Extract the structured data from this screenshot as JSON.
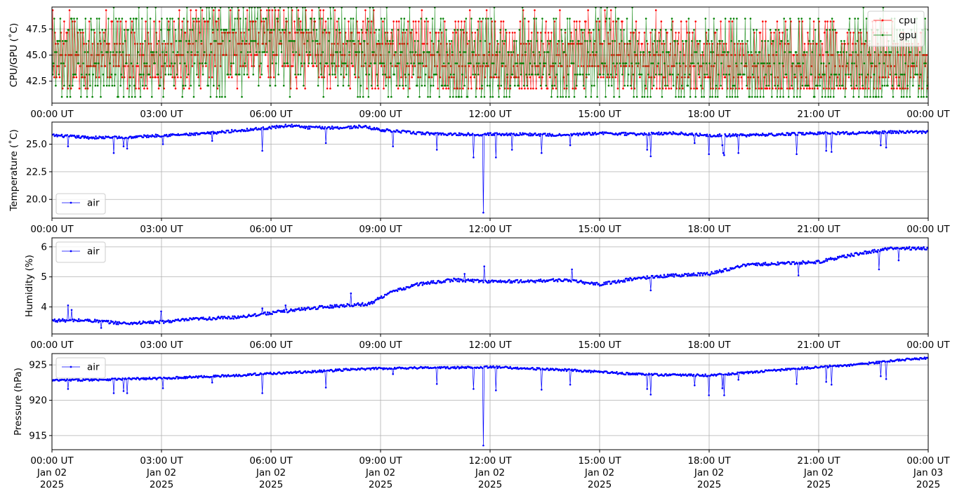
{
  "x_axis": {
    "time_ticks": [
      "00:00 UT",
      "03:00 UT",
      "06:00 UT",
      "09:00 UT",
      "12:00 UT",
      "15:00 UT",
      "18:00 UT",
      "21:00 UT",
      "00:00 UT"
    ],
    "date_ticks": [
      "Jan 02",
      "Jan 02",
      "Jan 02",
      "Jan 02",
      "Jan 02",
      "Jan 02",
      "Jan 02",
      "Jan 02",
      "Jan 03"
    ],
    "year_ticks": [
      "2025",
      "2025",
      "2025",
      "2025",
      "2025",
      "2025",
      "2025",
      "2025",
      "2025"
    ],
    "range": [
      "2025-01-02 00:00 UT",
      "2025-01-03 00:00 UT"
    ]
  },
  "chart_data": [
    {
      "type": "line",
      "ylabel": "CPU/GPU (˚C)",
      "ylim": [
        40.4,
        49.6
      ],
      "yticks": [
        42.5,
        45.0,
        47.5
      ],
      "ytick_labels": [
        "42.5",
        "45.0",
        "47.5"
      ],
      "grid": true,
      "legend_position": "upper right",
      "series": [
        {
          "name": "cpu",
          "color": "#ff0000",
          "marker": "dot",
          "x_hours": [
            0,
            3,
            6,
            9,
            12,
            15,
            18,
            21,
            24
          ],
          "values": [
            44.9,
            45.0,
            46.3,
            45.2,
            44.5,
            45.1,
            44.3,
            44.0,
            44.6
          ],
          "min": 41.8,
          "max": 48.8
        },
        {
          "name": "gpu",
          "color": "#008000",
          "marker": "dot",
          "x_hours": [
            0,
            3,
            6,
            9,
            12,
            15,
            18,
            21,
            24
          ],
          "values": [
            44.6,
            44.8,
            46.5,
            45.0,
            44.2,
            44.9,
            44.1,
            43.8,
            44.3
          ],
          "min": 41.0,
          "max": 49.4
        }
      ]
    },
    {
      "type": "line",
      "ylabel": "Temperature (˚C)",
      "ylim": [
        18.3,
        27.0
      ],
      "yticks": [
        20.0,
        22.5,
        25.0
      ],
      "ytick_labels": [
        "20.0",
        "22.5",
        "25.0"
      ],
      "grid": true,
      "legend_position": "lower left",
      "series": [
        {
          "name": "air",
          "color": "#0000ff",
          "marker": "dot",
          "x_hours": [
            0,
            1,
            2,
            3,
            4,
            5,
            6,
            6.5,
            7,
            8,
            8.5,
            9,
            10,
            11,
            12,
            13,
            14,
            15,
            16,
            17,
            18,
            19,
            20,
            21,
            22,
            23,
            24
          ],
          "values": [
            25.8,
            25.6,
            25.6,
            25.8,
            25.9,
            26.2,
            26.5,
            26.7,
            26.5,
            26.5,
            26.6,
            26.3,
            26.0,
            25.9,
            25.9,
            25.9,
            25.8,
            26.0,
            25.9,
            26.0,
            25.8,
            25.8,
            25.9,
            26.0,
            26.0,
            26.1,
            26.1
          ],
          "dips": [
            [
              0.45,
              24.8
            ],
            [
              1.7,
              24.2
            ],
            [
              1.95,
              24.8
            ],
            [
              2.05,
              24.6
            ],
            [
              3.05,
              25.0
            ],
            [
              4.4,
              25.3
            ],
            [
              5.75,
              24.4
            ],
            [
              7.5,
              25.1
            ],
            [
              9.35,
              24.8
            ],
            [
              10.55,
              24.5
            ],
            [
              11.55,
              23.8
            ],
            [
              11.82,
              18.8
            ],
            [
              12.17,
              23.8
            ],
            [
              12.6,
              24.5
            ],
            [
              13.4,
              24.2
            ],
            [
              14.2,
              24.9
            ],
            [
              16.3,
              24.5
            ],
            [
              16.4,
              23.9
            ],
            [
              17.6,
              25.1
            ],
            [
              18.0,
              24.1
            ],
            [
              18.35,
              24.9
            ],
            [
              18.38,
              24.2
            ],
            [
              18.42,
              24.0
            ],
            [
              18.8,
              24.2
            ],
            [
              20.4,
              24.1
            ],
            [
              21.2,
              24.4
            ],
            [
              21.35,
              24.3
            ],
            [
              22.7,
              24.9
            ],
            [
              22.85,
              24.7
            ]
          ]
        }
      ]
    },
    {
      "type": "line",
      "ylabel": "Humidity (%)",
      "ylim": [
        3.1,
        6.3
      ],
      "yticks": [
        4,
        5,
        6
      ],
      "ytick_labels": [
        "4",
        "5",
        "6"
      ],
      "grid": true,
      "legend_position": "upper left",
      "series": [
        {
          "name": "air",
          "color": "#0000ff",
          "marker": "dot",
          "x_hours": [
            0,
            1,
            2,
            3,
            4,
            5,
            6,
            7,
            8,
            8.7,
            9.2,
            10,
            11,
            12,
            13,
            14,
            15,
            16,
            17,
            18,
            19,
            20,
            21,
            22,
            23,
            24
          ],
          "values": [
            3.55,
            3.55,
            3.45,
            3.5,
            3.6,
            3.65,
            3.8,
            3.95,
            4.05,
            4.1,
            4.45,
            4.75,
            4.9,
            4.85,
            4.85,
            4.9,
            4.75,
            4.95,
            5.05,
            5.1,
            5.4,
            5.45,
            5.5,
            5.75,
            5.95,
            5.95
          ],
          "spikes": [
            [
              0.45,
              4.05
            ],
            [
              0.55,
              3.9
            ],
            [
              1.35,
              3.3
            ],
            [
              3.0,
              3.85
            ],
            [
              5.75,
              3.95
            ],
            [
              6.4,
              4.05
            ],
            [
              8.2,
              4.45
            ],
            [
              11.3,
              5.1
            ],
            [
              11.85,
              5.35
            ],
            [
              14.25,
              5.25
            ],
            [
              16.4,
              4.55
            ],
            [
              20.45,
              5.05
            ],
            [
              22.65,
              5.25
            ],
            [
              23.2,
              5.55
            ]
          ]
        }
      ]
    },
    {
      "type": "line",
      "ylabel": "Pressure (hPa)",
      "ylim": [
        913.0,
        926.6
      ],
      "yticks": [
        915,
        920,
        925
      ],
      "ytick_labels": [
        "915",
        "920",
        "925"
      ],
      "grid": true,
      "legend_position": "upper left",
      "series": [
        {
          "name": "air",
          "color": "#0000ff",
          "marker": "dot",
          "x_hours": [
            0,
            1,
            2,
            3,
            4,
            5,
            6,
            7,
            8,
            9,
            10,
            11,
            12,
            13,
            14,
            15,
            16,
            16.5,
            17,
            18,
            19,
            20,
            21,
            22,
            23,
            24
          ],
          "values": [
            922.8,
            922.9,
            923.0,
            923.1,
            923.3,
            923.5,
            923.8,
            924.0,
            924.3,
            924.5,
            924.6,
            924.6,
            924.7,
            924.5,
            924.3,
            924.0,
            923.7,
            923.6,
            923.6,
            923.5,
            923.9,
            924.3,
            924.7,
            925.0,
            925.6,
            926.0
          ],
          "dips": [
            [
              0.45,
              921.6
            ],
            [
              1.7,
              921.0
            ],
            [
              1.95,
              921.3
            ],
            [
              2.05,
              921.0
            ],
            [
              3.05,
              921.7
            ],
            [
              4.4,
              922.5
            ],
            [
              5.75,
              921.0
            ],
            [
              7.5,
              921.8
            ],
            [
              9.35,
              923.7
            ],
            [
              10.55,
              922.3
            ],
            [
              11.55,
              921.6
            ],
            [
              11.82,
              913.6
            ],
            [
              12.17,
              921.4
            ],
            [
              13.4,
              921.5
            ],
            [
              14.2,
              922.2
            ],
            [
              16.3,
              921.6
            ],
            [
              16.4,
              920.8
            ],
            [
              17.6,
              922.1
            ],
            [
              18.0,
              920.7
            ],
            [
              18.35,
              921.7
            ],
            [
              18.42,
              920.7
            ],
            [
              18.8,
              922.9
            ],
            [
              20.4,
              922.3
            ],
            [
              21.2,
              922.6
            ],
            [
              21.35,
              922.2
            ],
            [
              22.7,
              923.4
            ],
            [
              22.85,
              923.0
            ]
          ]
        }
      ]
    }
  ]
}
